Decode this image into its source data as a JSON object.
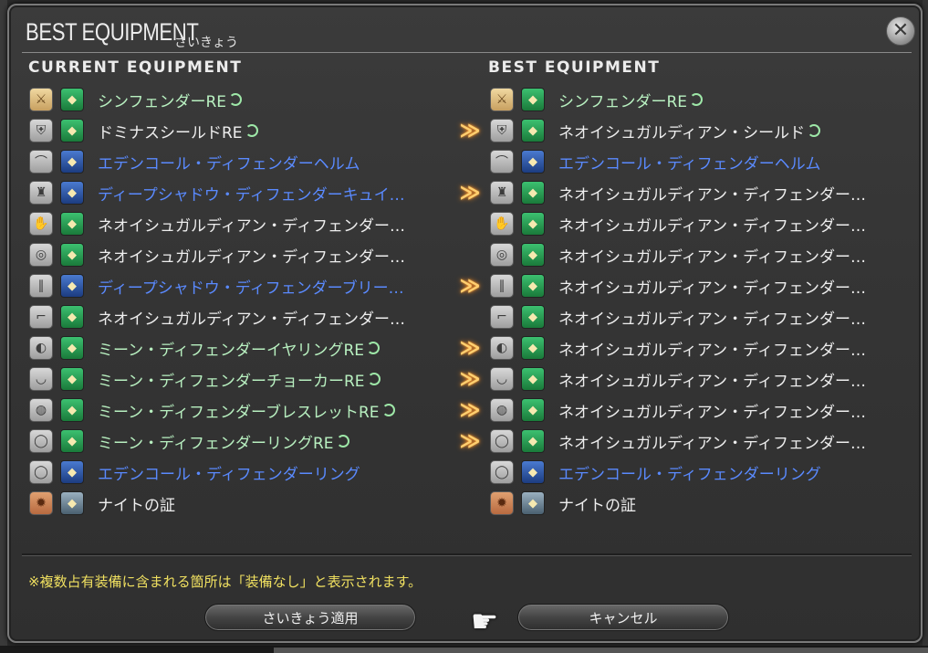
{
  "window": {
    "title": "BEST EQUIPMENT",
    "subtitle": "さいきょう"
  },
  "headers": {
    "current": "CURRENT EQUIPMENT",
    "best": "BEST EQUIPMENT"
  },
  "current": [
    {
      "name": "シンフェンダーRE",
      "hq": true,
      "color": "green",
      "slot_icon": "sword-icon",
      "item_color": "green"
    },
    {
      "name": "ドミナスシールドRE",
      "hq": true,
      "color": "white",
      "slot_icon": "shield-icon",
      "item_color": "green"
    },
    {
      "name": "エデンコール・ディフェンダーヘルム",
      "hq": false,
      "color": "blue",
      "slot_icon": "helm-icon",
      "item_color": "blue"
    },
    {
      "name": "ディープシャドウ・ディフェンダーキュイ…",
      "hq": false,
      "color": "blue",
      "slot_icon": "body-icon",
      "item_color": "blue"
    },
    {
      "name": "ネオイシュガルディアン・ディフェンダー…",
      "hq": false,
      "color": "white",
      "slot_icon": "gloves-icon",
      "item_color": "green"
    },
    {
      "name": "ネオイシュガルディアン・ディフェンダー…",
      "hq": false,
      "color": "white",
      "slot_icon": "belt-icon",
      "item_color": "green"
    },
    {
      "name": "ディープシャドウ・ディフェンダーブリー…",
      "hq": false,
      "color": "blue",
      "slot_icon": "legs-icon",
      "item_color": "blue"
    },
    {
      "name": "ネオイシュガルディアン・ディフェンダー…",
      "hq": false,
      "color": "white",
      "slot_icon": "feet-icon",
      "item_color": "green"
    },
    {
      "name": "ミーン・ディフェンダーイヤリングRE",
      "hq": true,
      "color": "green",
      "slot_icon": "earring-icon",
      "item_color": "green"
    },
    {
      "name": "ミーン・ディフェンダーチョーカーRE",
      "hq": true,
      "color": "green",
      "slot_icon": "necklace-icon",
      "item_color": "green"
    },
    {
      "name": "ミーン・ディフェンダーブレスレットRE",
      "hq": true,
      "color": "green",
      "slot_icon": "bracelet-icon",
      "item_color": "green"
    },
    {
      "name": "ミーン・ディフェンダーリングRE",
      "hq": true,
      "color": "green",
      "slot_icon": "ring-icon",
      "item_color": "green"
    },
    {
      "name": "エデンコール・ディフェンダーリング",
      "hq": false,
      "color": "blue",
      "slot_icon": "ring-icon",
      "item_color": "blue"
    },
    {
      "name": "ナイトの証",
      "hq": false,
      "color": "white",
      "slot_icon": "soul-crystal-icon",
      "item_color": "teal"
    }
  ],
  "best": [
    {
      "name": "シンフェンダーRE",
      "hq": true,
      "color": "green",
      "slot_icon": "sword-icon",
      "item_color": "green",
      "upgrade": false
    },
    {
      "name": "ネオイシュガルディアン・シールド",
      "hq": true,
      "color": "white",
      "slot_icon": "shield-icon",
      "item_color": "green",
      "upgrade": true
    },
    {
      "name": "エデンコール・ディフェンダーヘルム",
      "hq": false,
      "color": "blue",
      "slot_icon": "helm-icon",
      "item_color": "blue",
      "upgrade": false
    },
    {
      "name": "ネオイシュガルディアン・ディフェンダー…",
      "hq": false,
      "color": "white",
      "slot_icon": "body-icon",
      "item_color": "green",
      "upgrade": true
    },
    {
      "name": "ネオイシュガルディアン・ディフェンダー…",
      "hq": false,
      "color": "white",
      "slot_icon": "gloves-icon",
      "item_color": "green",
      "upgrade": false
    },
    {
      "name": "ネオイシュガルディアン・ディフェンダー…",
      "hq": false,
      "color": "white",
      "slot_icon": "belt-icon",
      "item_color": "green",
      "upgrade": false
    },
    {
      "name": "ネオイシュガルディアン・ディフェンダー…",
      "hq": false,
      "color": "white",
      "slot_icon": "legs-icon",
      "item_color": "green",
      "upgrade": true
    },
    {
      "name": "ネオイシュガルディアン・ディフェンダー…",
      "hq": false,
      "color": "white",
      "slot_icon": "feet-icon",
      "item_color": "green",
      "upgrade": false
    },
    {
      "name": "ネオイシュガルディアン・ディフェンダー…",
      "hq": false,
      "color": "white",
      "slot_icon": "earring-icon",
      "item_color": "green",
      "upgrade": true
    },
    {
      "name": "ネオイシュガルディアン・ディフェンダー…",
      "hq": false,
      "color": "white",
      "slot_icon": "necklace-icon",
      "item_color": "green",
      "upgrade": true
    },
    {
      "name": "ネオイシュガルディアン・ディフェンダー…",
      "hq": false,
      "color": "white",
      "slot_icon": "bracelet-icon",
      "item_color": "green",
      "upgrade": true
    },
    {
      "name": "ネオイシュガルディアン・ディフェンダー…",
      "hq": false,
      "color": "white",
      "slot_icon": "ring-icon",
      "item_color": "green",
      "upgrade": true
    },
    {
      "name": "エデンコール・ディフェンダーリング",
      "hq": false,
      "color": "blue",
      "slot_icon": "ring-icon",
      "item_color": "blue",
      "upgrade": false
    },
    {
      "name": "ナイトの証",
      "hq": false,
      "color": "white",
      "slot_icon": "soul-crystal-icon",
      "item_color": "teal",
      "upgrade": false
    }
  ],
  "footer": {
    "note": "※複数占有装備に含まれる箇所は「装備なし」と表示されます。",
    "apply_label": "さいきょう適用",
    "cancel_label": "キャンセル"
  },
  "colors": {
    "green_text": "#b8f0c0",
    "blue_text": "#5a8aff",
    "white_text": "#eeeeee",
    "note_text": "#f0e060",
    "arrow": "#ffcf70"
  }
}
